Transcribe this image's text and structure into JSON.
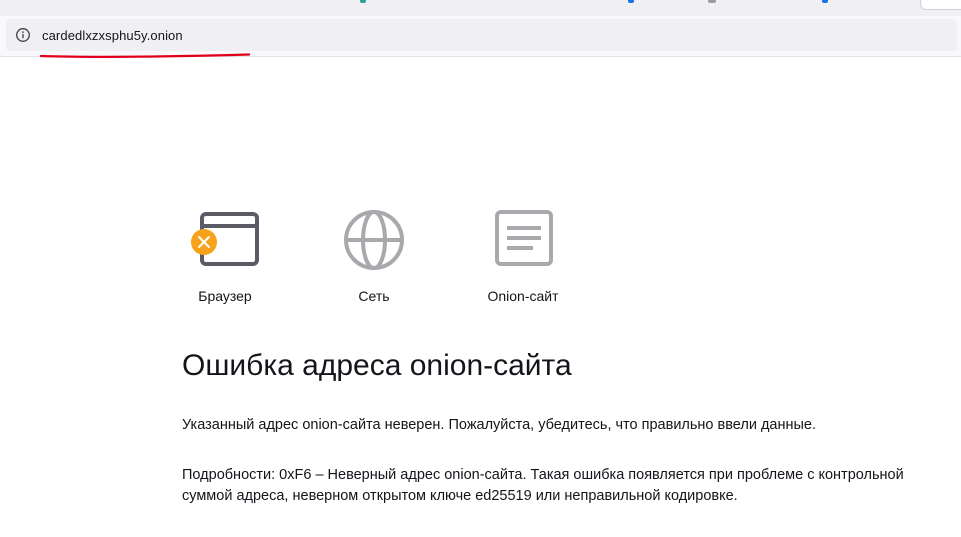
{
  "browser": {
    "address_bar": {
      "url": "cardedlxzxsphu5y.onion",
      "info_icon": "info-icon"
    },
    "annotation_color": "#e0001a"
  },
  "error": {
    "steps": [
      {
        "label": "Браузер",
        "icon": "browser-window-icon",
        "status": "error",
        "badge_color": "#f7a21b"
      },
      {
        "label": "Сеть",
        "icon": "globe-icon",
        "status": "ok"
      },
      {
        "label": "Onion-сайт",
        "icon": "document-icon",
        "status": "ok"
      }
    ],
    "title": "Ошибка адреса onion-сайта",
    "message": "Указанный адрес onion-сайта неверен. Пожалуйста, убедитесь, что правильно ввели данные.",
    "details": "Подробности: 0xF6 – Неверный адрес onion-сайта. Такая ошибка появляется при проблеме с контрольной суммой адреса, неверном открытом ключе ed25519 или неправильной кодировке."
  }
}
